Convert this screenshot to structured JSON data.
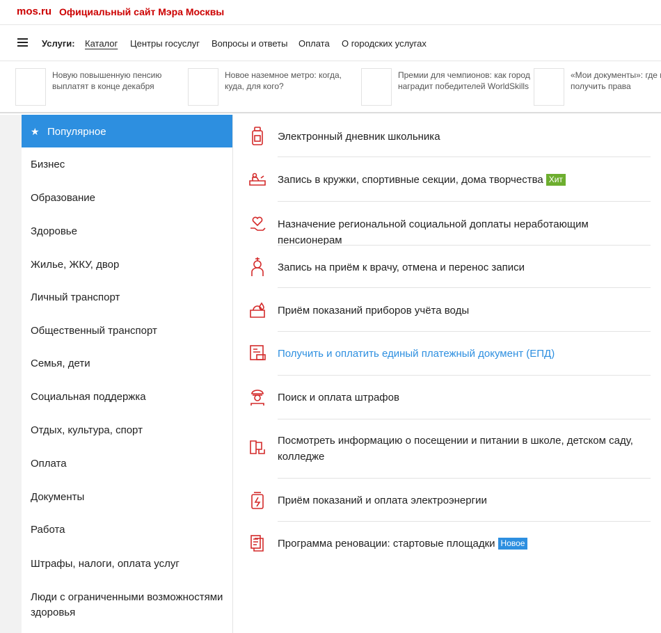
{
  "header": {
    "logo": "mos.ru",
    "site_title": "Официальный сайт Мэра Москвы"
  },
  "nav": {
    "label": "Услуги:",
    "links": [
      "Каталог",
      "Центры госуслуг",
      "Вопросы и ответы",
      "Оплата",
      "О городских услугах"
    ]
  },
  "news": [
    {
      "text": "Новую повышенную пенсию выплатят в конце декабря"
    },
    {
      "text": "Новое наземное метро: когда, куда, для кого?"
    },
    {
      "text": "Премии для чемпионов: как город наградит победителей WorldSkills"
    },
    {
      "text": "«Мои документы»: где и как получить права"
    }
  ],
  "sidebar": {
    "items": [
      "Популярное",
      "Бизнес",
      "Образование",
      "Здоровье",
      "Жилье, ЖКУ, двор",
      "Личный транспорт",
      "Общественный транспорт",
      "Семья, дети",
      "Социальная поддержка",
      "Отдых, культура, спорт",
      "Оплата",
      "Документы",
      "Работа",
      "Штрафы, налоги, оплата услуг",
      "Люди с ограниченными возможностями здоровья"
    ]
  },
  "services": [
    {
      "text": "Электронный дневник школьника",
      "icon": "school-diary-icon"
    },
    {
      "text": "Запись в кружки, спортивные секции, дома творчества",
      "icon": "clubs-icon",
      "badge": "Хит"
    },
    {
      "text": "Назначение региональной социальной доплаты неработающим пенсионерам",
      "icon": "heart-hand-icon"
    },
    {
      "text": "Запись на приём к врачу, отмена и перенос записи",
      "icon": "doctor-icon"
    },
    {
      "text": "Приём показаний приборов учёта воды",
      "icon": "water-meter-icon"
    },
    {
      "text": "Получить и оплатить единый платежный документ (ЕПД)",
      "icon": "payment-document-icon"
    },
    {
      "text": "Поиск и оплата штрафов",
      "icon": "police-officer-icon"
    },
    {
      "text": "Посмотреть информацию о посещении и питании в школе, детском саду, колледже",
      "icon": "school-meals-icon"
    },
    {
      "text": "Приём показаний и оплата электроэнергии",
      "icon": "electricity-icon"
    },
    {
      "text": "Программа реновации: стартовые площадки",
      "icon": "renovation-document-icon",
      "badge": "Новое"
    }
  ],
  "colors": {
    "brand_red": "#cc0000",
    "accent_blue": "#2d8fe0",
    "badge_green": "#6dae2f",
    "icon_red": "#d42a2a"
  }
}
